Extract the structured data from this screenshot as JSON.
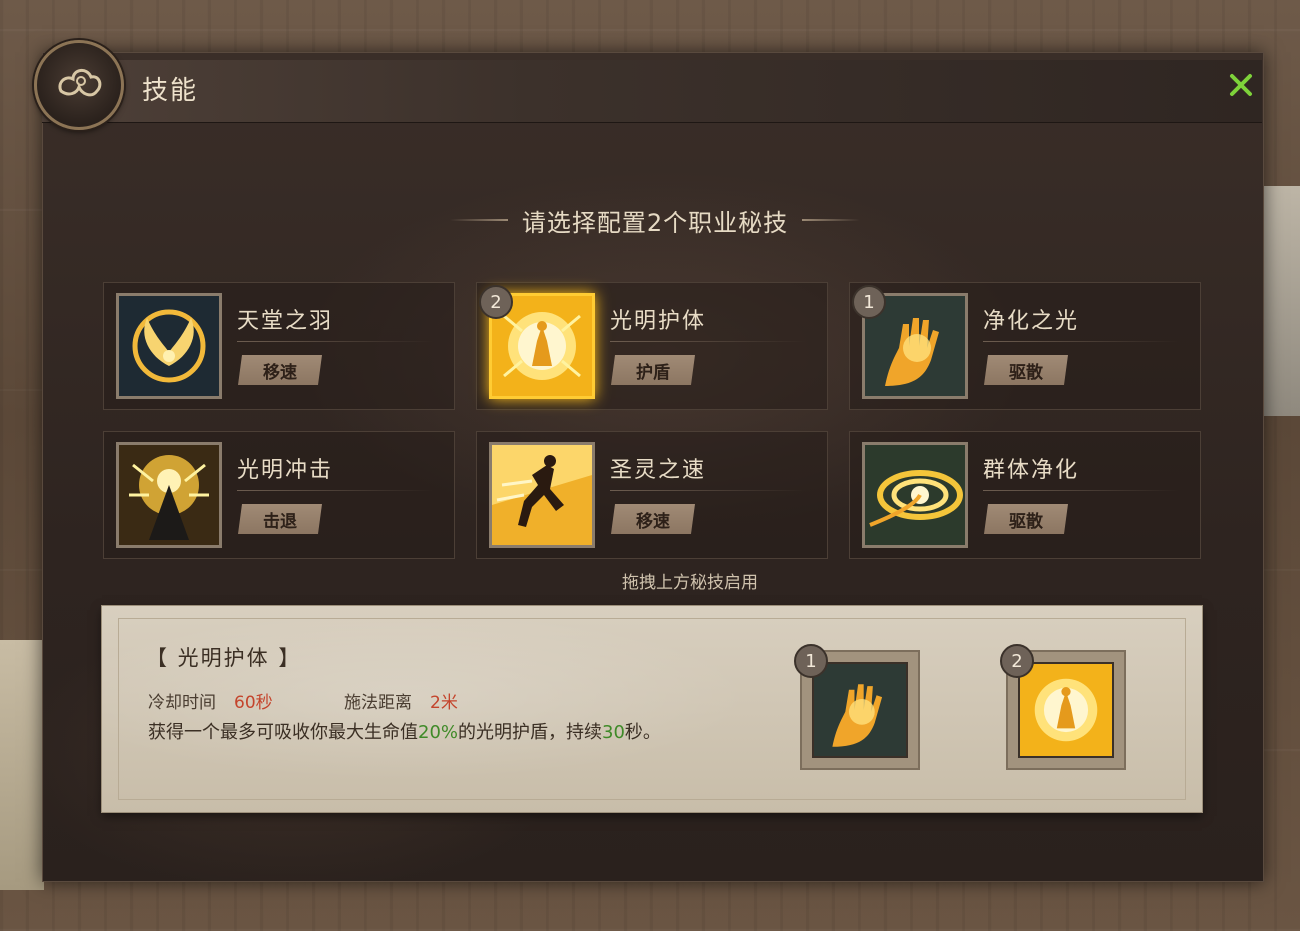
{
  "window": {
    "title": "技能",
    "close_icon": "close-icon"
  },
  "heading": "请选择配置2个职业秘技",
  "skills": [
    {
      "name": "天堂之羽",
      "tag": "移速",
      "icon": "golden-wings-icon",
      "order": null,
      "selected": false
    },
    {
      "name": "光明护体",
      "tag": "护盾",
      "icon": "holy-shield-icon",
      "order": "2",
      "selected": true
    },
    {
      "name": "净化之光",
      "tag": "驱散",
      "icon": "glowing-hand-icon",
      "order": "1",
      "selected": false
    },
    {
      "name": "光明冲击",
      "tag": "击退",
      "icon": "holy-burst-icon",
      "order": null,
      "selected": false
    },
    {
      "name": "圣灵之速",
      "tag": "移速",
      "icon": "running-warrior-icon",
      "order": null,
      "selected": false
    },
    {
      "name": "群体净化",
      "tag": "驱散",
      "icon": "light-vortex-icon",
      "order": null,
      "selected": false
    }
  ],
  "hint": "拖拽上方秘技启用",
  "detail": {
    "title": "【 光明护体 】",
    "cooldown_label": "冷却时间",
    "cooldown_value": "60秒",
    "range_label": "施法距离",
    "range_value": "2米",
    "desc_part1": "获得一个最多可吸收你最大生命值",
    "desc_highlight1": "20%",
    "desc_part2": "的光明护盾，持续",
    "desc_highlight2": "30",
    "desc_part3": "秒。"
  },
  "slots": [
    {
      "order": "1",
      "icon": "glowing-hand-icon"
    },
    {
      "order": "2",
      "icon": "holy-shield-icon"
    }
  ],
  "colors": {
    "accent_gold": "#ffcc33",
    "highlight_green": "#3f8a28",
    "value_red": "#c4442c",
    "close_green": "#7ed23a"
  }
}
